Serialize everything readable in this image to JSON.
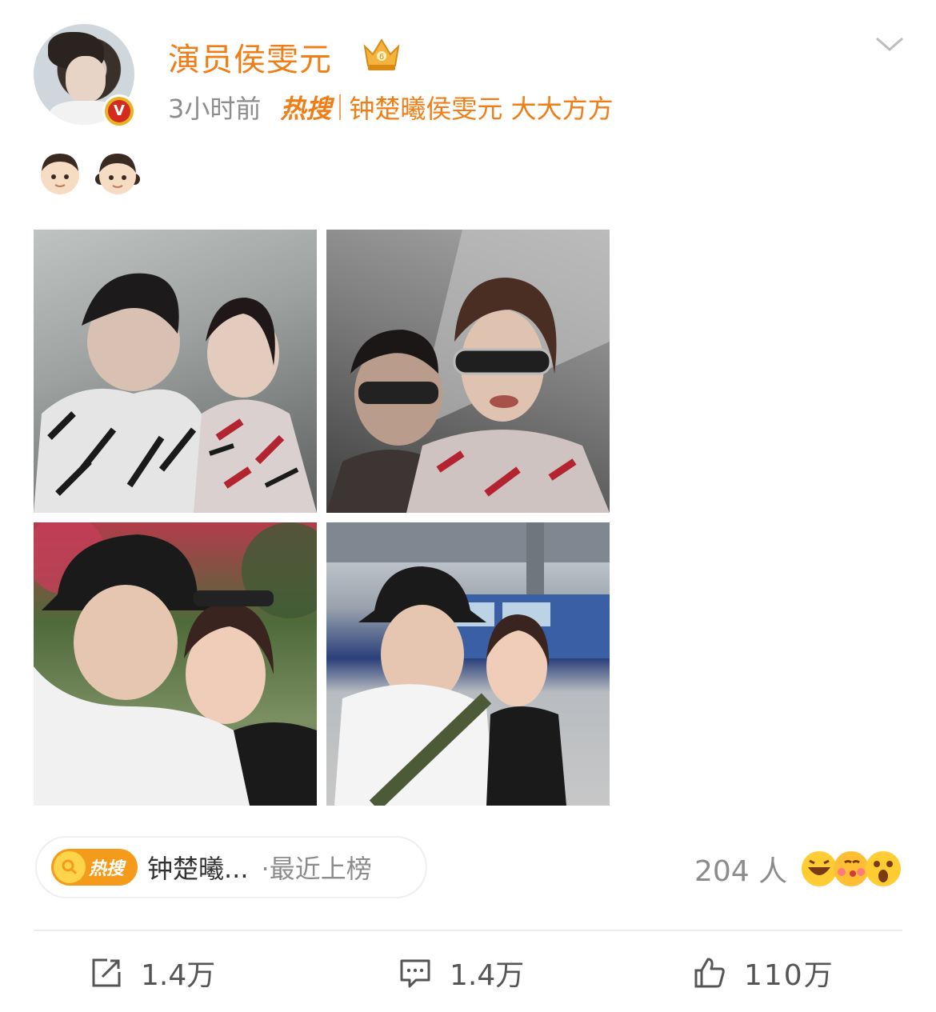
{
  "post": {
    "username": "演员侯雯元",
    "time": "3小时前",
    "hot_label": "热搜",
    "topic": "钟楚曦侯雯元 大大方方",
    "emoji_icons": [
      "boy-emoji-icon",
      "girl-emoji-icon"
    ]
  },
  "photos": [
    {
      "name": "photo-couple-patterned-shirts"
    },
    {
      "name": "photo-couple-sunglasses"
    },
    {
      "name": "photo-couple-bucket-hat-park"
    },
    {
      "name": "photo-couple-train-platform"
    }
  ],
  "hot_search": {
    "label": "热搜",
    "topic": "钟楚曦...",
    "status": "·最近上榜"
  },
  "reactions": {
    "count": "204 人",
    "icons": [
      "laugh-emoji-icon",
      "kiss-emoji-icon",
      "surprised-emoji-icon"
    ]
  },
  "actions": {
    "share": "1.4万",
    "comment": "1.4万",
    "like": "110万"
  },
  "colors": {
    "accent": "#f07d16",
    "secondary_text": "#8c8c8c",
    "divider": "#ececec"
  }
}
